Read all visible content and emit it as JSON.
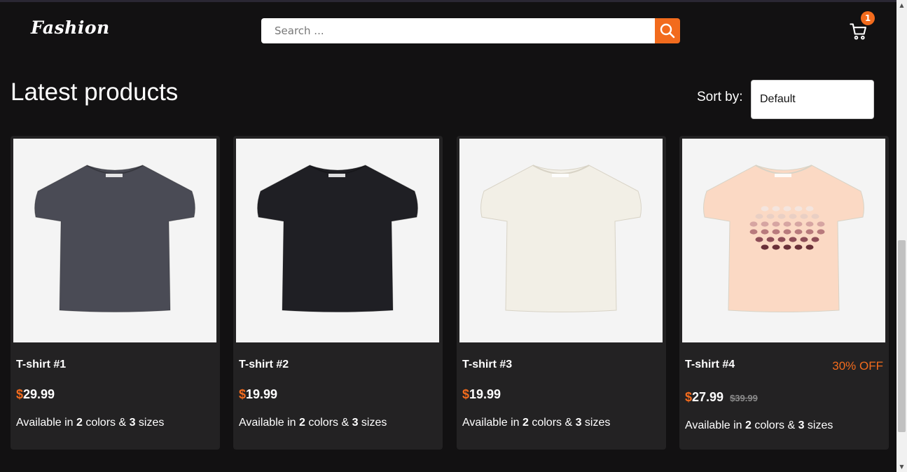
{
  "header": {
    "logo": "Fashion",
    "search_placeholder": "Search ...",
    "cart_count": "1",
    "accent_color": "#f26b1d"
  },
  "main": {
    "title": "Latest products",
    "sort_label": "Sort by:",
    "sort_value": "Default"
  },
  "products": [
    {
      "name": "T-shirt #1",
      "currency": "$",
      "price": "29.99",
      "old_price": "",
      "discount": "",
      "avail_prefix": "Available in ",
      "colors": "2",
      "avail_mid": " colors & ",
      "sizes": "3",
      "avail_suffix": " sizes",
      "shirt_color": "#4a4b55"
    },
    {
      "name": "T-shirt #2",
      "currency": "$",
      "price": "19.99",
      "old_price": "",
      "discount": "",
      "avail_prefix": "Available in ",
      "colors": "2",
      "avail_mid": " colors & ",
      "sizes": "3",
      "avail_suffix": " sizes",
      "shirt_color": "#1f1f24"
    },
    {
      "name": "T-shirt #3",
      "currency": "$",
      "price": "19.99",
      "old_price": "",
      "discount": "",
      "avail_prefix": "Available in ",
      "colors": "2",
      "avail_mid": " colors & ",
      "sizes": "3",
      "avail_suffix": " sizes",
      "shirt_color": "#f2efe6"
    },
    {
      "name": "T-shirt #4",
      "currency": "$",
      "price": "27.99",
      "old_price": "$39.99",
      "discount": "30% OFF",
      "avail_prefix": "Available in ",
      "colors": "2",
      "avail_mid": " colors & ",
      "sizes": "3",
      "avail_suffix": " sizes",
      "shirt_color": "#fbd9c4"
    }
  ]
}
